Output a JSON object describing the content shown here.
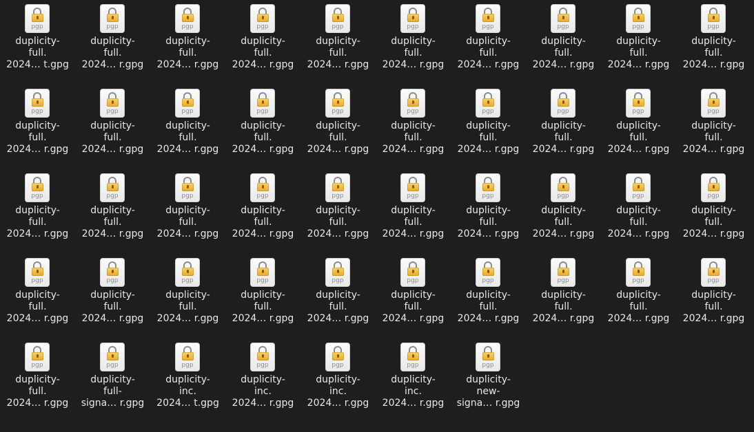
{
  "files": [
    {
      "name_lines": [
        "duplicity-",
        "full.",
        "2024… t.gpg"
      ],
      "ext_label": "pgp",
      "icon": "encrypted-lock-icon"
    },
    {
      "name_lines": [
        "duplicity-",
        "full.",
        "2024… r.gpg"
      ],
      "ext_label": "pgp",
      "icon": "encrypted-lock-icon"
    },
    {
      "name_lines": [
        "duplicity-",
        "full.",
        "2024… r.gpg"
      ],
      "ext_label": "pgp",
      "icon": "encrypted-lock-icon"
    },
    {
      "name_lines": [
        "duplicity-",
        "full.",
        "2024… r.gpg"
      ],
      "ext_label": "pgp",
      "icon": "encrypted-lock-icon"
    },
    {
      "name_lines": [
        "duplicity-",
        "full.",
        "2024… r.gpg"
      ],
      "ext_label": "pgp",
      "icon": "encrypted-lock-icon"
    },
    {
      "name_lines": [
        "duplicity-",
        "full.",
        "2024… r.gpg"
      ],
      "ext_label": "pgp",
      "icon": "encrypted-lock-icon"
    },
    {
      "name_lines": [
        "duplicity-",
        "full.",
        "2024… r.gpg"
      ],
      "ext_label": "pgp",
      "icon": "encrypted-lock-icon"
    },
    {
      "name_lines": [
        "duplicity-",
        "full.",
        "2024… r.gpg"
      ],
      "ext_label": "pgp",
      "icon": "encrypted-lock-icon"
    },
    {
      "name_lines": [
        "duplicity-",
        "full.",
        "2024… r.gpg"
      ],
      "ext_label": "pgp",
      "icon": "encrypted-lock-icon"
    },
    {
      "name_lines": [
        "duplicity-",
        "full.",
        "2024… r.gpg"
      ],
      "ext_label": "pgp",
      "icon": "encrypted-lock-icon"
    },
    {
      "name_lines": [
        "duplicity-",
        "full.",
        "2024… r.gpg"
      ],
      "ext_label": "pgp",
      "icon": "encrypted-lock-icon"
    },
    {
      "name_lines": [
        "duplicity-",
        "full.",
        "2024… r.gpg"
      ],
      "ext_label": "pgp",
      "icon": "encrypted-lock-icon"
    },
    {
      "name_lines": [
        "duplicity-",
        "full.",
        "2024… r.gpg"
      ],
      "ext_label": "pgp",
      "icon": "encrypted-lock-icon"
    },
    {
      "name_lines": [
        "duplicity-",
        "full.",
        "2024… r.gpg"
      ],
      "ext_label": "pgp",
      "icon": "encrypted-lock-icon"
    },
    {
      "name_lines": [
        "duplicity-",
        "full.",
        "2024… r.gpg"
      ],
      "ext_label": "pgp",
      "icon": "encrypted-lock-icon"
    },
    {
      "name_lines": [
        "duplicity-",
        "full.",
        "2024… r.gpg"
      ],
      "ext_label": "pgp",
      "icon": "encrypted-lock-icon"
    },
    {
      "name_lines": [
        "duplicity-",
        "full.",
        "2024… r.gpg"
      ],
      "ext_label": "pgp",
      "icon": "encrypted-lock-icon"
    },
    {
      "name_lines": [
        "duplicity-",
        "full.",
        "2024… r.gpg"
      ],
      "ext_label": "pgp",
      "icon": "encrypted-lock-icon"
    },
    {
      "name_lines": [
        "duplicity-",
        "full.",
        "2024… r.gpg"
      ],
      "ext_label": "pgp",
      "icon": "encrypted-lock-icon"
    },
    {
      "name_lines": [
        "duplicity-",
        "full.",
        "2024… r.gpg"
      ],
      "ext_label": "pgp",
      "icon": "encrypted-lock-icon"
    },
    {
      "name_lines": [
        "duplicity-",
        "full.",
        "2024… r.gpg"
      ],
      "ext_label": "pgp",
      "icon": "encrypted-lock-icon"
    },
    {
      "name_lines": [
        "duplicity-",
        "full.",
        "2024… r.gpg"
      ],
      "ext_label": "pgp",
      "icon": "encrypted-lock-icon"
    },
    {
      "name_lines": [
        "duplicity-",
        "full.",
        "2024… r.gpg"
      ],
      "ext_label": "pgp",
      "icon": "encrypted-lock-icon"
    },
    {
      "name_lines": [
        "duplicity-",
        "full.",
        "2024… r.gpg"
      ],
      "ext_label": "pgp",
      "icon": "encrypted-lock-icon"
    },
    {
      "name_lines": [
        "duplicity-",
        "full.",
        "2024… r.gpg"
      ],
      "ext_label": "pgp",
      "icon": "encrypted-lock-icon"
    },
    {
      "name_lines": [
        "duplicity-",
        "full.",
        "2024… r.gpg"
      ],
      "ext_label": "pgp",
      "icon": "encrypted-lock-icon"
    },
    {
      "name_lines": [
        "duplicity-",
        "full.",
        "2024… r.gpg"
      ],
      "ext_label": "pgp",
      "icon": "encrypted-lock-icon"
    },
    {
      "name_lines": [
        "duplicity-",
        "full.",
        "2024… r.gpg"
      ],
      "ext_label": "pgp",
      "icon": "encrypted-lock-icon"
    },
    {
      "name_lines": [
        "duplicity-",
        "full.",
        "2024… r.gpg"
      ],
      "ext_label": "pgp",
      "icon": "encrypted-lock-icon"
    },
    {
      "name_lines": [
        "duplicity-",
        "full.",
        "2024… r.gpg"
      ],
      "ext_label": "pgp",
      "icon": "encrypted-lock-icon"
    },
    {
      "name_lines": [
        "duplicity-",
        "full.",
        "2024… r.gpg"
      ],
      "ext_label": "pgp",
      "icon": "encrypted-lock-icon"
    },
    {
      "name_lines": [
        "duplicity-",
        "full.",
        "2024… r.gpg"
      ],
      "ext_label": "pgp",
      "icon": "encrypted-lock-icon"
    },
    {
      "name_lines": [
        "duplicity-",
        "full.",
        "2024… r.gpg"
      ],
      "ext_label": "pgp",
      "icon": "encrypted-lock-icon"
    },
    {
      "name_lines": [
        "duplicity-",
        "full.",
        "2024… r.gpg"
      ],
      "ext_label": "pgp",
      "icon": "encrypted-lock-icon"
    },
    {
      "name_lines": [
        "duplicity-",
        "full.",
        "2024… r.gpg"
      ],
      "ext_label": "pgp",
      "icon": "encrypted-lock-icon"
    },
    {
      "name_lines": [
        "duplicity-",
        "full.",
        "2024… r.gpg"
      ],
      "ext_label": "pgp",
      "icon": "encrypted-lock-icon"
    },
    {
      "name_lines": [
        "duplicity-",
        "full.",
        "2024… r.gpg"
      ],
      "ext_label": "pgp",
      "icon": "encrypted-lock-icon"
    },
    {
      "name_lines": [
        "duplicity-",
        "full.",
        "2024… r.gpg"
      ],
      "ext_label": "pgp",
      "icon": "encrypted-lock-icon"
    },
    {
      "name_lines": [
        "duplicity-",
        "full.",
        "2024… r.gpg"
      ],
      "ext_label": "pgp",
      "icon": "encrypted-lock-icon"
    },
    {
      "name_lines": [
        "duplicity-",
        "full.",
        "2024… r.gpg"
      ],
      "ext_label": "pgp",
      "icon": "encrypted-lock-icon"
    },
    {
      "name_lines": [
        "duplicity-",
        "full.",
        "2024… r.gpg"
      ],
      "ext_label": "pgp",
      "icon": "encrypted-lock-icon"
    },
    {
      "name_lines": [
        "duplicity-",
        "full-",
        "signa… r.gpg"
      ],
      "ext_label": "pgp",
      "icon": "encrypted-lock-icon"
    },
    {
      "name_lines": [
        "duplicity-",
        "inc.",
        "2024… t.gpg"
      ],
      "ext_label": "pgp",
      "icon": "encrypted-lock-icon"
    },
    {
      "name_lines": [
        "duplicity-",
        "inc.",
        "2024… r.gpg"
      ],
      "ext_label": "pgp",
      "icon": "encrypted-lock-icon"
    },
    {
      "name_lines": [
        "duplicity-",
        "inc.",
        "2024… r.gpg"
      ],
      "ext_label": "pgp",
      "icon": "encrypted-lock-icon"
    },
    {
      "name_lines": [
        "duplicity-",
        "inc.",
        "2024… r.gpg"
      ],
      "ext_label": "pgp",
      "icon": "encrypted-lock-icon"
    },
    {
      "name_lines": [
        "duplicity-",
        "new-",
        "signa… r.gpg"
      ],
      "ext_label": "pgp",
      "icon": "encrypted-lock-icon"
    }
  ]
}
